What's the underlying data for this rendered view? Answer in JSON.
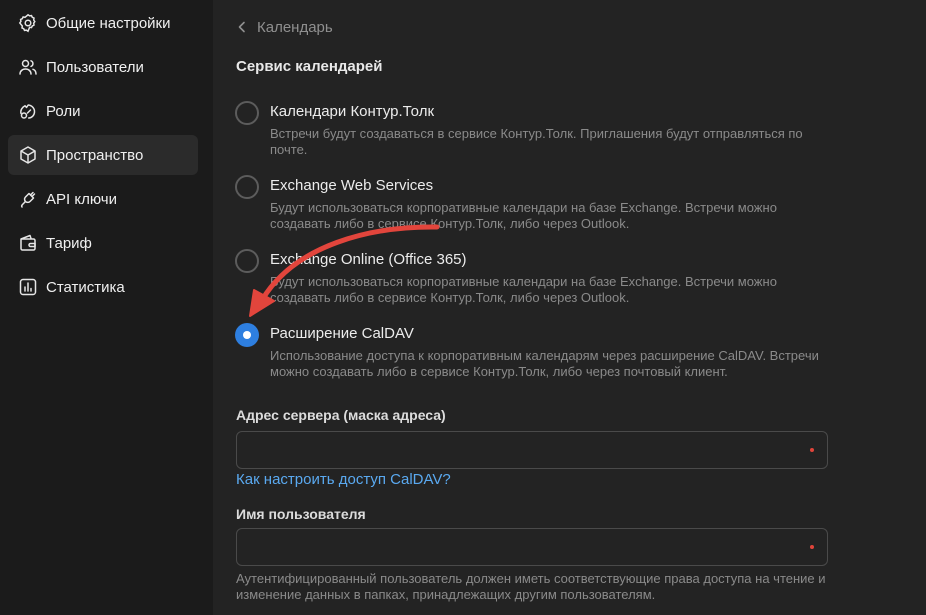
{
  "sidebar": {
    "items": [
      {
        "label": "Общие настройки",
        "icon": "gear-icon"
      },
      {
        "label": "Пользователи",
        "icon": "users-icon"
      },
      {
        "label": "Роли",
        "icon": "roles-icon"
      },
      {
        "label": "Пространство",
        "icon": "cube-icon",
        "active": true
      },
      {
        "label": "API ключи",
        "icon": "plug-icon"
      },
      {
        "label": "Тариф",
        "icon": "wallet-icon"
      },
      {
        "label": "Статистика",
        "icon": "chart-icon"
      }
    ]
  },
  "main": {
    "back_label": "Календарь",
    "section_title": "Сервис календарей",
    "options": [
      {
        "title": "Календари Контур.Толк",
        "description": "Встречи будут создаваться в сервисе Контур.Толк. Приглашения будут отправляться по почте.",
        "checked": false
      },
      {
        "title": "Exchange Web Services",
        "description": "Будут использоваться корпоративные календари на базе Exchange. Встречи можно создавать либо в сервисе Контур.Толк, либо через Outlook.",
        "checked": false
      },
      {
        "title": "Exchange Online (Office 365)",
        "description": "Будут использоваться корпоративные календари на базе Exchange. Встречи можно создавать либо в сервисе Контур.Толк, либо через Outlook.",
        "checked": false
      },
      {
        "title": "Расширение CalDAV",
        "description": "Использование доступа к корпоративным календарям через расширение CalDAV. Встречи можно создавать либо в сервисе Контур.Толк, либо через почтовый клиент.",
        "checked": true
      }
    ],
    "server_field": {
      "label": "Адрес сервера (маска адреса)",
      "value": "",
      "required": true
    },
    "help_link": "Как настроить доступ CalDAV?",
    "username_field": {
      "label": "Имя пользователя",
      "value": "",
      "required": true
    },
    "username_hint": "Аутентифицированный пользователь должен иметь соответствующие права доступа на чтение и изменение данных в папках, принадлежащих другим пользователям."
  },
  "colors": {
    "accent": "#2e7fe0",
    "link": "#5aa9f0",
    "annotation_arrow": "#e2453c",
    "required_dot": "#e0443a"
  }
}
